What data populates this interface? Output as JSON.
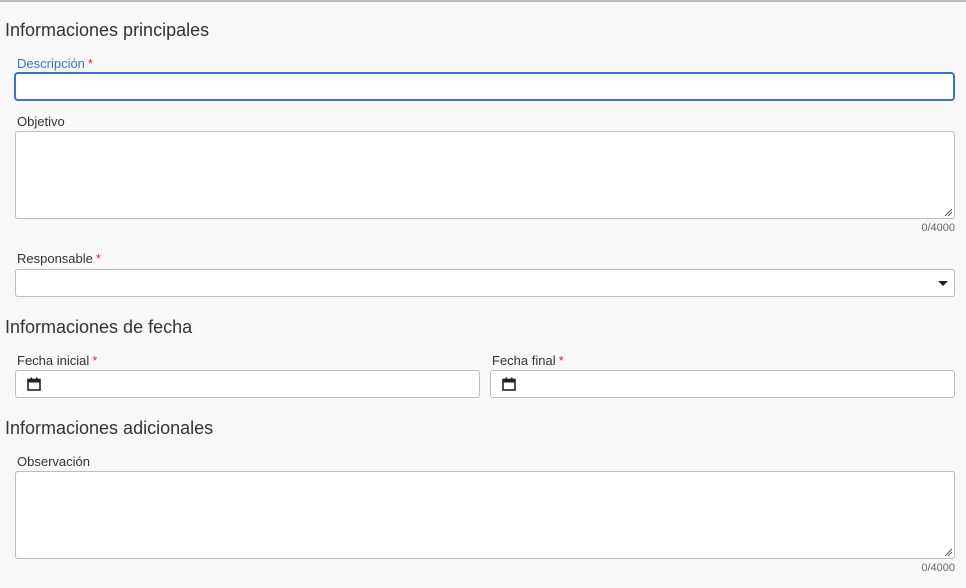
{
  "sections": {
    "main": "Informaciones principales",
    "dates": "Informaciones de fecha",
    "additional": "Informaciones adicionales"
  },
  "fields": {
    "descripcion": {
      "label": "Descripción",
      "required_mark": "*",
      "value": ""
    },
    "objetivo": {
      "label": "Objetivo",
      "value": "",
      "counter": "0/4000"
    },
    "responsable": {
      "label": "Responsable",
      "required_mark": "*",
      "selected": ""
    },
    "fecha_inicial": {
      "label": "Fecha inicial",
      "required_mark": "*",
      "value": ""
    },
    "fecha_final": {
      "label": "Fecha final",
      "required_mark": "*",
      "value": ""
    },
    "observacion": {
      "label": "Observación",
      "value": "",
      "counter": "0/4000"
    }
  },
  "icons": {
    "calendar": "calendar-icon",
    "dropdown": "chevron-down-icon"
  },
  "colors": {
    "accent": "#3b73c7",
    "required": "#d32f2f",
    "border": "#bdbdbd",
    "background": "#f8f8f8"
  }
}
